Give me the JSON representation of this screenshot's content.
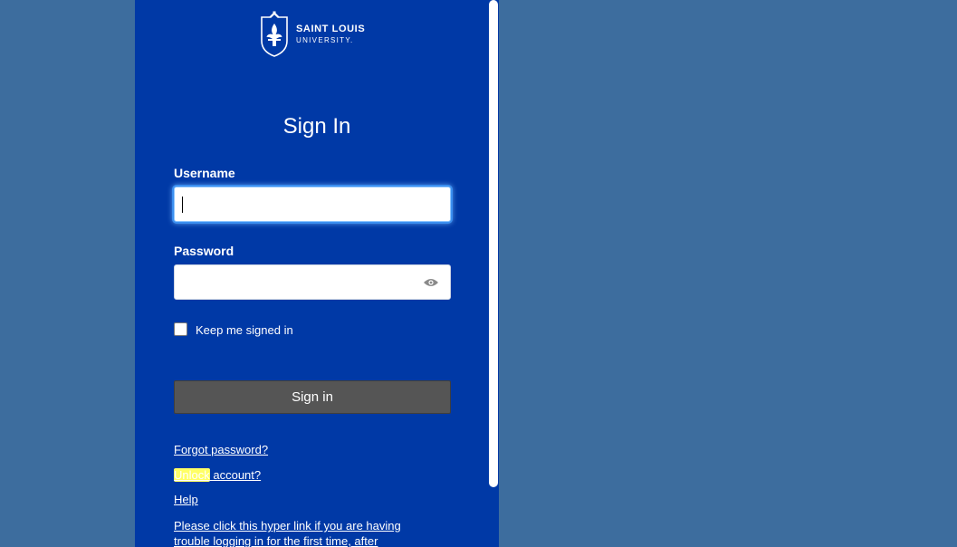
{
  "brand": {
    "line1": "SAINT LOUIS",
    "line2": "UNIVERSITY."
  },
  "page": {
    "title": "Sign In"
  },
  "form": {
    "username_label": "Username",
    "username_value": "",
    "password_label": "Password",
    "password_value": "",
    "keep_signed_in_label": "Keep me signed in",
    "keep_signed_in_checked": false,
    "submit_label": "Sign in"
  },
  "links": {
    "forgot_password": "Forgot password?",
    "unlock_highlight": "Unlock",
    "unlock_rest": " account?",
    "help": "Help",
    "first_time_line1": "Please click this hyper link if you are having",
    "first_time_line2": "trouble logging in for the first time, after"
  },
  "colors": {
    "background": "#3d6d9e",
    "panel": "#0039a6",
    "button": "#555555",
    "highlight": "#ffff66"
  },
  "icons": {
    "logo": "slu-seal-icon",
    "password_toggle": "eye-icon"
  }
}
